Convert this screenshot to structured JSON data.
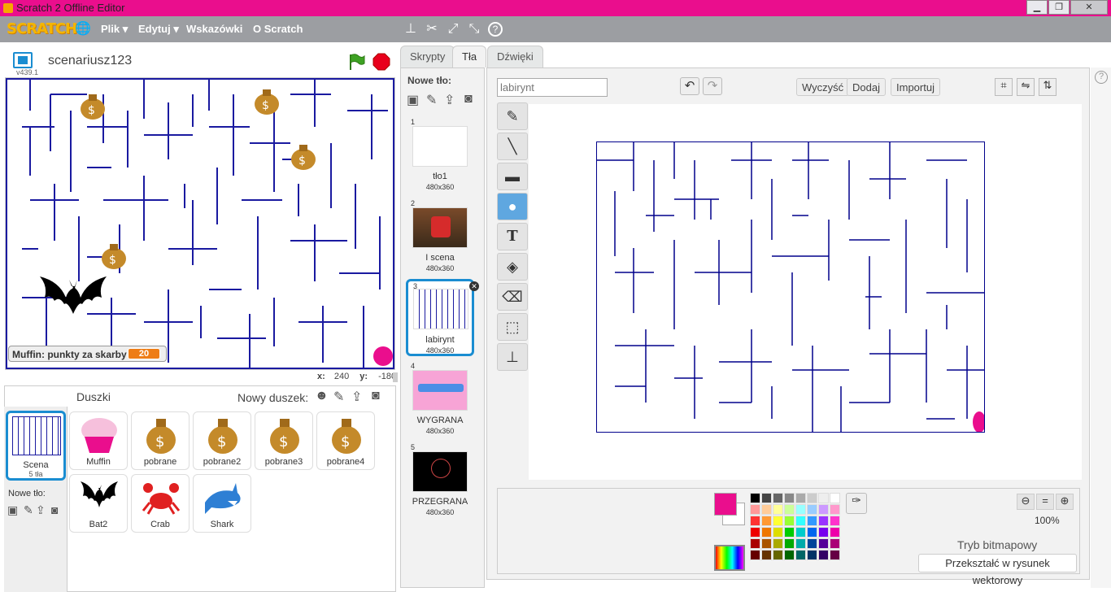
{
  "window": {
    "title": "Scratch 2 Offline Editor",
    "min": "▁",
    "max": "❐",
    "close": "✕"
  },
  "menu": {
    "logo": "SCRATCH",
    "file": "Plik ▾",
    "edit": "Edytuj ▾",
    "tips": "Wskazówki",
    "about": "O Scratch",
    "globe": "🌐",
    "help": "?"
  },
  "stage": {
    "project_name": "scenariusz123",
    "version": "v439.1",
    "monitor_label": "Muffin: punkty za skarby",
    "monitor_value": "20",
    "x_label": "x:",
    "x_value": "240",
    "y_label": "y:",
    "y_value": "-180"
  },
  "sprites": {
    "header": "Duszki",
    "new_sprite": "Nowy duszek:",
    "scene_label": "Scena",
    "scene_sub": "5 tła",
    "new_backdrop": "Nowe tło:",
    "items": [
      "Muffin",
      "pobrane",
      "pobrane2",
      "pobrane3",
      "pobrane4",
      "Bat2",
      "Crab",
      "Shark"
    ]
  },
  "tabs": {
    "scripts": "Skrypty",
    "backdrops": "Tła",
    "sounds": "Dźwięki"
  },
  "costumes": {
    "new_label": "Nowe tło:",
    "items": [
      {
        "num": "1",
        "name": "tło1",
        "size": "480x360"
      },
      {
        "num": "2",
        "name": "I scena",
        "size": "480x360"
      },
      {
        "num": "3",
        "name": "labirynt",
        "size": "480x360"
      },
      {
        "num": "4",
        "name": "WYGRANA",
        "size": "480x360"
      },
      {
        "num": "5",
        "name": "PRZEGRANA",
        "size": "480x360"
      }
    ]
  },
  "editor": {
    "name_value": "labirynt",
    "clear": "Wyczyść",
    "add": "Dodaj",
    "import": "Importuj",
    "zoom": "100%",
    "mode": "Tryb bitmapowy",
    "convert": "Przekształć w rysunek wektorowy",
    "primary_color": "#ea0e8d"
  },
  "colors": {
    "titlebar": "#ea0e8d",
    "menubar": "#9c9ea2",
    "maze_wall": "#00008b",
    "selected": "#5fa7e0"
  }
}
